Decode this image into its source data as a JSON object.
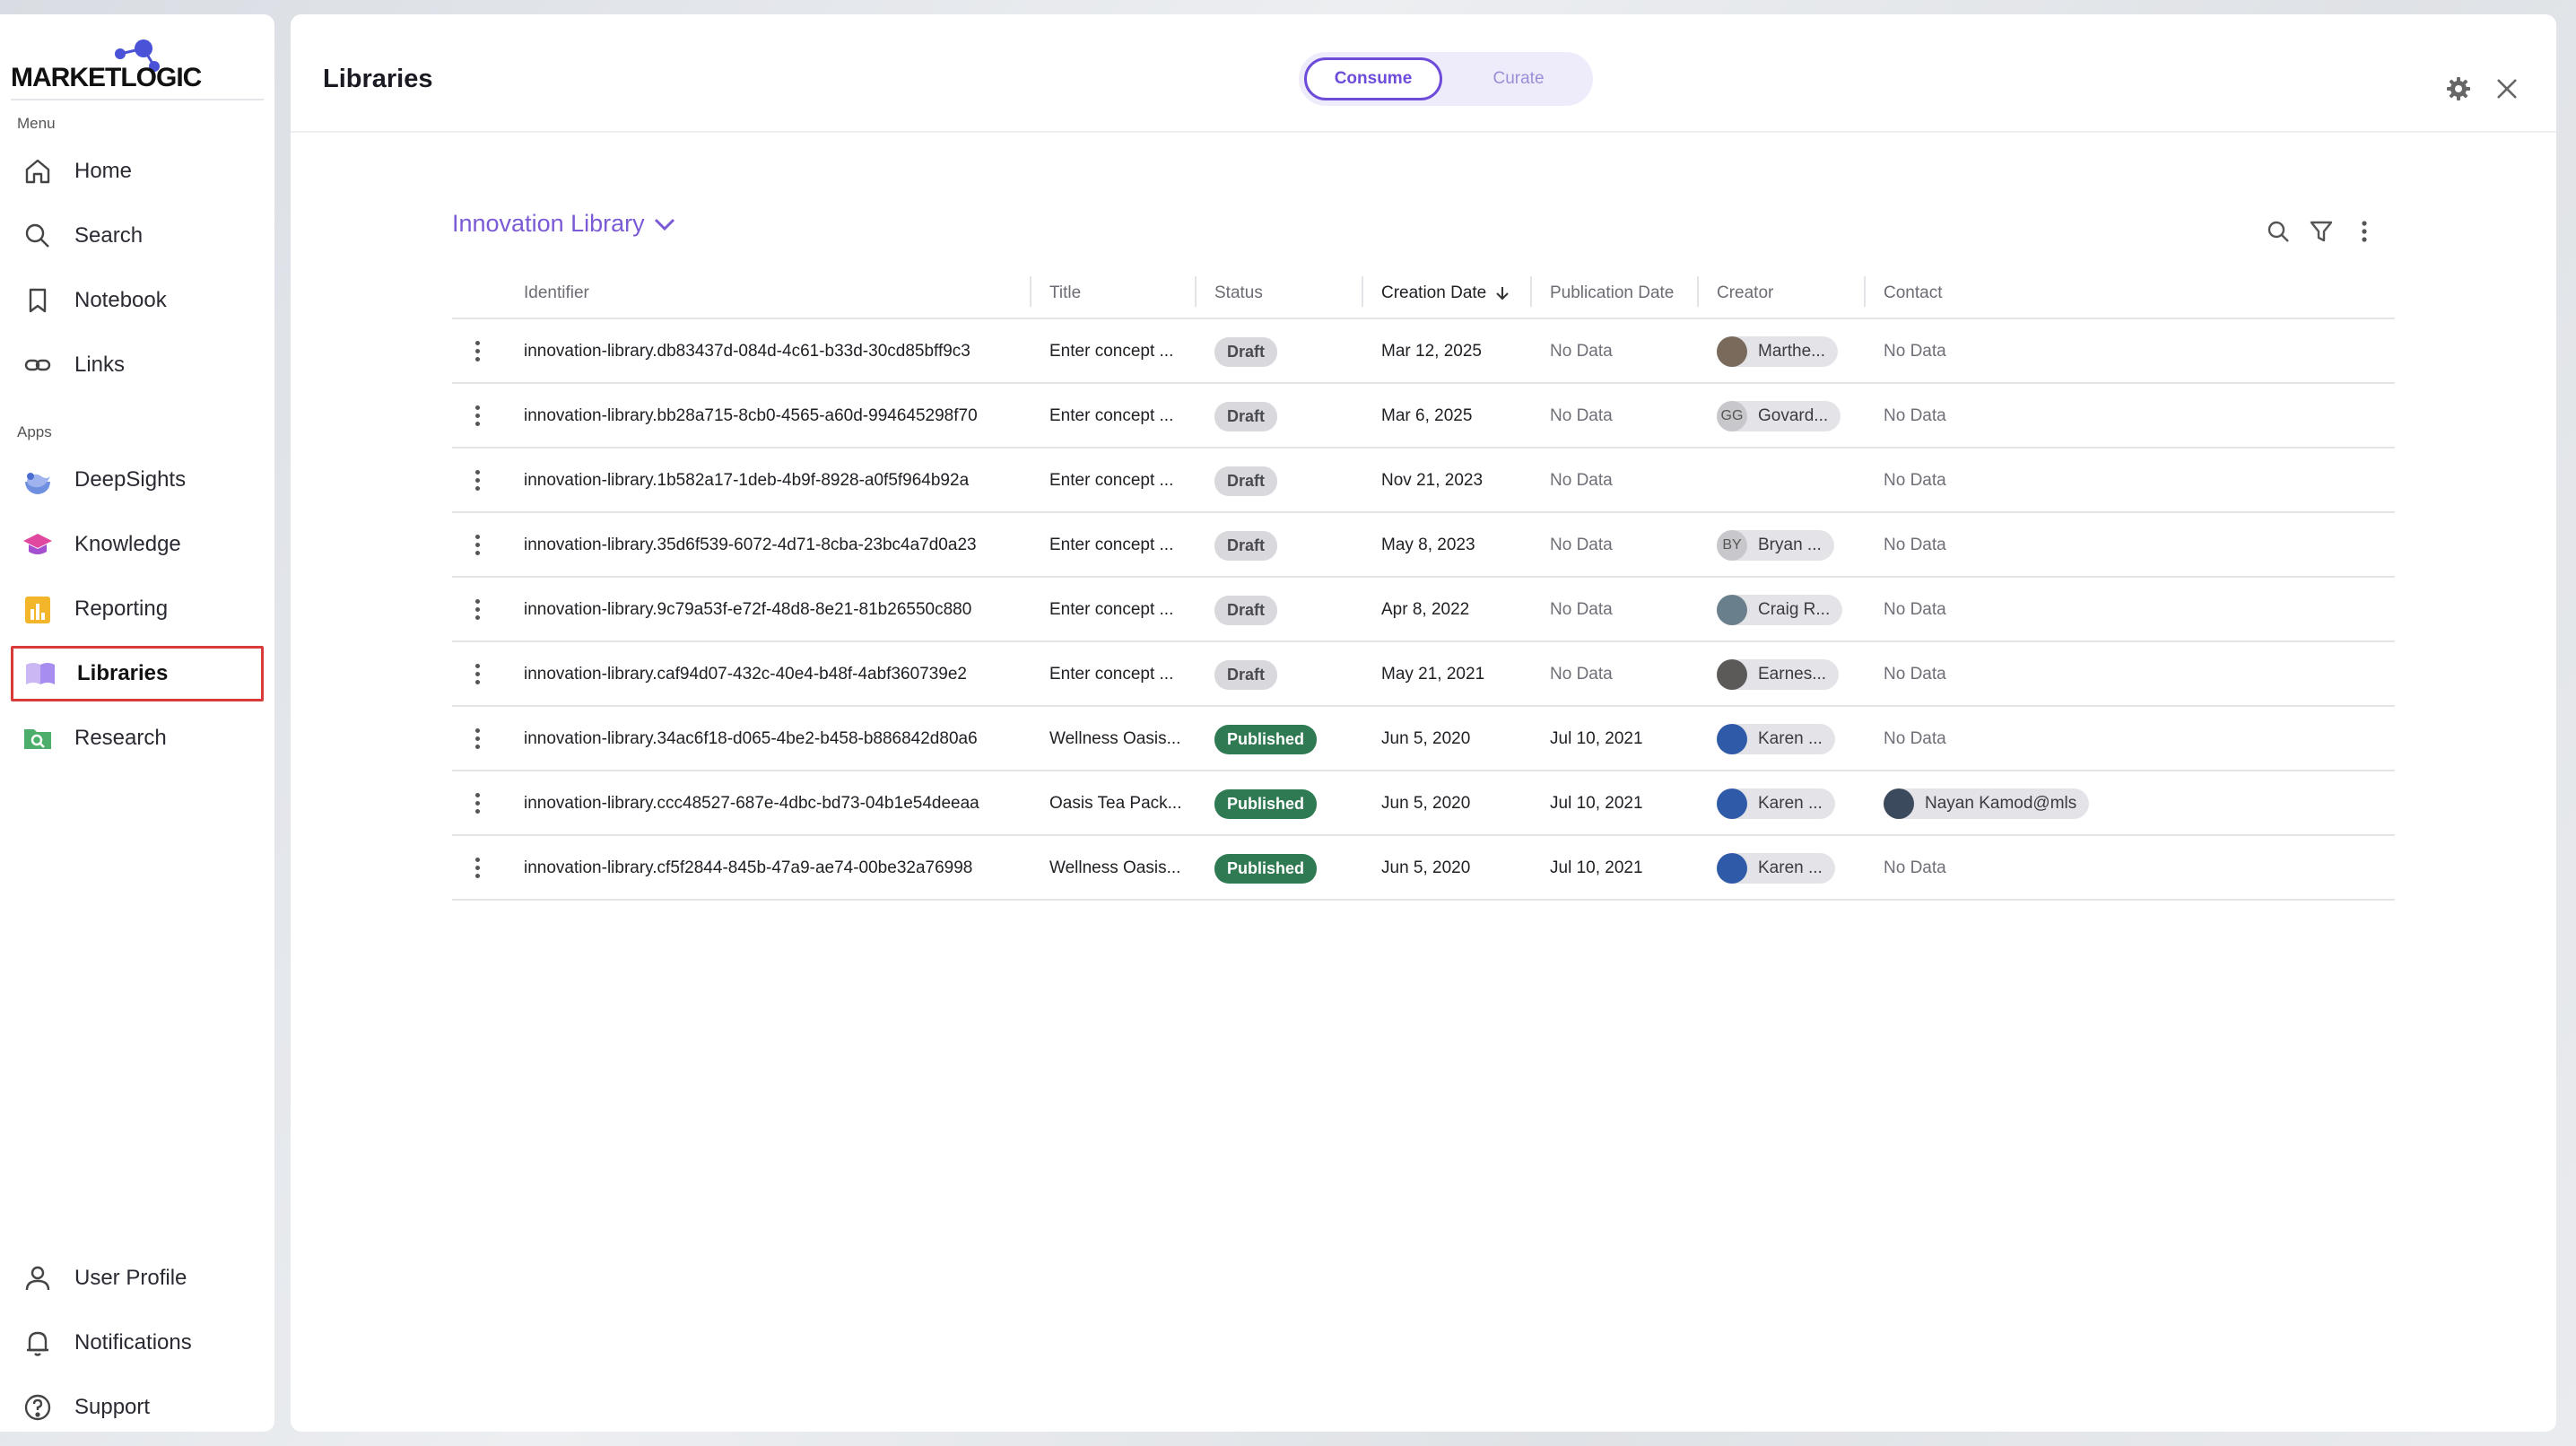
{
  "sidebar": {
    "logo_text": "MARKETLOGIC",
    "menu_label": "Menu",
    "menu_items": [
      {
        "label": "Home",
        "icon": "home-icon"
      },
      {
        "label": "Search",
        "icon": "search-icon"
      },
      {
        "label": "Notebook",
        "icon": "bookmark-icon"
      },
      {
        "label": "Links",
        "icon": "link-icon"
      }
    ],
    "apps_label": "Apps",
    "app_items": [
      {
        "label": "DeepSights",
        "icon": "deepsights-icon"
      },
      {
        "label": "Knowledge",
        "icon": "knowledge-icon"
      },
      {
        "label": "Reporting",
        "icon": "reporting-icon"
      },
      {
        "label": "Libraries",
        "icon": "libraries-icon",
        "active": true
      },
      {
        "label": "Research",
        "icon": "research-icon"
      }
    ],
    "bottom_items": [
      {
        "label": "User Profile",
        "icon": "user-icon"
      },
      {
        "label": "Notifications",
        "icon": "bell-icon"
      },
      {
        "label": "Support",
        "icon": "help-icon"
      }
    ]
  },
  "header": {
    "title": "Libraries",
    "toggle": {
      "consume": "Consume",
      "curate": "Curate",
      "selected": "Consume"
    }
  },
  "library": {
    "name": "Innovation Library"
  },
  "table": {
    "columns": [
      "Identifier",
      "Title",
      "Status",
      "Creation Date",
      "Publication Date",
      "Creator",
      "Contact"
    ],
    "sort_column": "Creation Date",
    "sort_direction": "descending",
    "rows": [
      {
        "identifier": "innovation-library.db83437d-084d-4c61-b33d-30cd85bff9c3",
        "title": "Enter concept ...",
        "status": "Draft",
        "creation_date": "Mar 12, 2025",
        "publication_date": "No Data",
        "creator": "Marthe...",
        "creator_initials": "",
        "contact": "No Data"
      },
      {
        "identifier": "innovation-library.bb28a715-8cb0-4565-a60d-994645298f70",
        "title": "Enter concept ...",
        "status": "Draft",
        "creation_date": "Mar 6, 2025",
        "publication_date": "No Data",
        "creator": "Govard...",
        "creator_initials": "GG",
        "contact": "No Data"
      },
      {
        "identifier": "innovation-library.1b582a17-1deb-4b9f-8928-a0f5f964b92a",
        "title": "Enter concept ...",
        "status": "Draft",
        "creation_date": "Nov 21, 2023",
        "publication_date": "No Data",
        "creator": "",
        "creator_initials": "",
        "contact": "No Data"
      },
      {
        "identifier": "innovation-library.35d6f539-6072-4d71-8cba-23bc4a7d0a23",
        "title": "Enter concept ...",
        "status": "Draft",
        "creation_date": "May 8, 2023",
        "publication_date": "No Data",
        "creator": "Bryan ...",
        "creator_initials": "BY",
        "contact": "No Data"
      },
      {
        "identifier": "innovation-library.9c79a53f-e72f-48d8-8e21-81b26550c880",
        "title": "Enter concept ...",
        "status": "Draft",
        "creation_date": "Apr 8, 2022",
        "publication_date": "No Data",
        "creator": "Craig R...",
        "creator_initials": "",
        "contact": "No Data"
      },
      {
        "identifier": "innovation-library.caf94d07-432c-40e4-b48f-4abf360739e2",
        "title": "Enter concept ...",
        "status": "Draft",
        "creation_date": "May 21, 2021",
        "publication_date": "No Data",
        "creator": "Earnes...",
        "creator_initials": "",
        "contact": "No Data"
      },
      {
        "identifier": "innovation-library.34ac6f18-d065-4be2-b458-b886842d80a6",
        "title": "Wellness Oasis...",
        "status": "Published",
        "creation_date": "Jun 5, 2020",
        "publication_date": "Jul 10, 2021",
        "creator": "Karen ...",
        "creator_initials": "",
        "contact": "No Data"
      },
      {
        "identifier": "innovation-library.ccc48527-687e-4dbc-bd73-04b1e54deeaa",
        "title": "Oasis Tea Pack...",
        "status": "Published",
        "creation_date": "Jun 5, 2020",
        "publication_date": "Jul 10, 2021",
        "creator": "Karen ...",
        "creator_initials": "",
        "contact": "Nayan Kamod@mls"
      },
      {
        "identifier": "innovation-library.cf5f2844-845b-47a9-ae74-00be32a76998",
        "title": "Wellness Oasis...",
        "status": "Published",
        "creation_date": "Jun 5, 2020",
        "publication_date": "Jul 10, 2021",
        "creator": "Karen ...",
        "creator_initials": "",
        "contact": "No Data"
      }
    ]
  },
  "colors": {
    "accent": "#6c4cd9",
    "published": "#2f7a52",
    "draft": "#d9d9dd",
    "active_outline": "#d93a3a"
  }
}
